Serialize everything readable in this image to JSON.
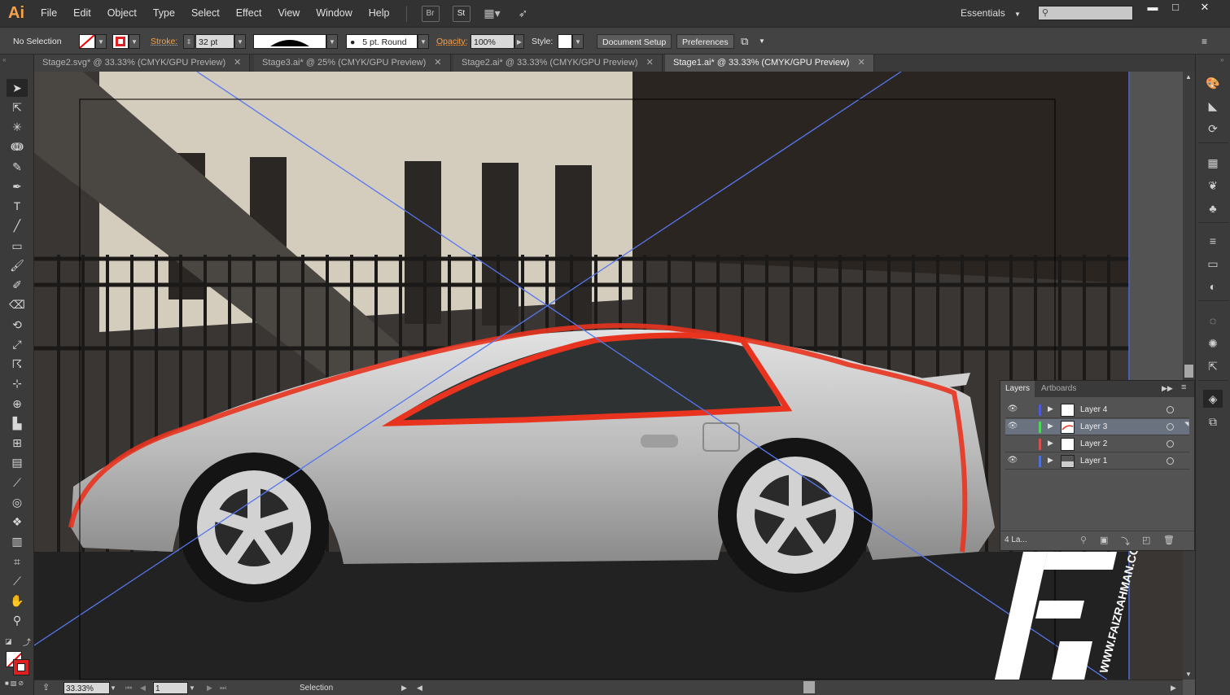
{
  "app": {
    "logo": "Ai"
  },
  "menu": [
    "File",
    "Edit",
    "Object",
    "Type",
    "Select",
    "Effect",
    "View",
    "Window",
    "Help"
  ],
  "menubar_buttons": {
    "bridge": "Br",
    "stock": "St"
  },
  "workspace": {
    "label": "Essentials"
  },
  "window_controls": {
    "minimize": "▬",
    "maximize": "□",
    "close": "✕"
  },
  "control": {
    "selection": "No Selection",
    "stroke_label": "Stroke:",
    "stroke_value": "32 pt",
    "brush_label": "5 pt. Round",
    "opacity_label": "Opacity:",
    "opacity_value": "100%",
    "style_label": "Style:",
    "document_setup": "Document Setup",
    "preferences": "Preferences"
  },
  "tabs": [
    {
      "label": "Stage2.svg* @ 33.33% (CMYK/GPU Preview)",
      "active": false
    },
    {
      "label": "Stage3.ai* @ 25% (CMYK/GPU Preview)",
      "active": false
    },
    {
      "label": "Stage2.ai* @ 33.33% (CMYK/GPU Preview)",
      "active": false
    },
    {
      "label": "Stage1.ai* @ 33.33% (CMYK/GPU Preview)",
      "active": true
    }
  ],
  "tools": [
    "selection-tool-icon",
    "direct-selection-tool-icon",
    "magic-wand-tool-icon",
    "lasso-tool-icon",
    "pen-tool-icon",
    "curvature-tool-icon",
    "type-tool-icon",
    "line-tool-icon",
    "rectangle-tool-icon",
    "paintbrush-tool-icon",
    "blob-brush-tool-icon",
    "eraser-tool-icon",
    "rotate-tool-icon",
    "scale-tool-icon",
    "warp-tool-icon",
    "free-transform-tool-icon",
    "shape-builder-tool-icon",
    "perspective-grid-tool-icon",
    "mesh-tool-icon",
    "gradient-tool-icon",
    "eyedropper-tool-icon",
    "blend-tool-icon",
    "symbol-sprayer-tool-icon",
    "column-graph-tool-icon",
    "artboard-tool-icon",
    "slice-tool-icon",
    "hand-tool-icon",
    "zoom-tool-icon"
  ],
  "layers_panel": {
    "tab_layers": "Layers",
    "tab_artboards": "Artboards",
    "layers": [
      {
        "name": "Layer 4",
        "color": "#4f5bd5",
        "visible": true,
        "selected": false
      },
      {
        "name": "Layer 3",
        "color": "#4fd55b",
        "visible": true,
        "selected": true
      },
      {
        "name": "Layer 2",
        "color": "#d54f4f",
        "visible": false,
        "selected": false
      },
      {
        "name": "Layer 1",
        "color": "#4f6fd5",
        "visible": true,
        "selected": false
      }
    ],
    "count": "4 La..."
  },
  "status": {
    "zoom": "33.33%",
    "artboard": "1",
    "tool": "Selection"
  },
  "watermark": "WWW.FAIZRAHMAN.COM"
}
